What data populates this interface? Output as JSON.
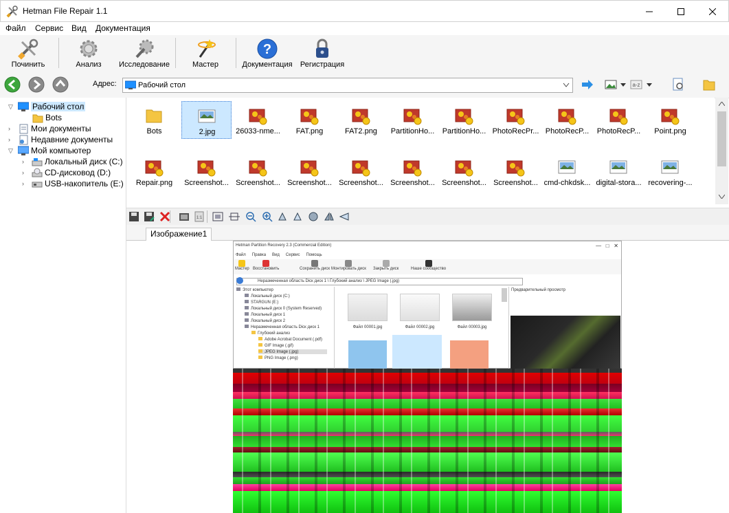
{
  "window": {
    "title": "Hetman File Repair 1.1"
  },
  "menu": [
    "Файл",
    "Сервис",
    "Вид",
    "Документация"
  ],
  "toolbar": {
    "repair": "Починить",
    "analyze": "Анализ",
    "research": "Исследование",
    "wizard": "Мастер",
    "docs": "Документация",
    "register": "Регистрация"
  },
  "address": {
    "label": "Адрес:",
    "value": "Рабочий стол"
  },
  "tree": {
    "desktop": "Рабочий стол",
    "bots": "Bots",
    "my_docs": "Мои документы",
    "recent": "Недавние документы",
    "computer": "Мой компьютер",
    "disk_c": "Локальный диск (C:)",
    "cd_d": "CD-дисковод (D:)",
    "usb_e": "USB-накопитель (E:)"
  },
  "files": [
    "Bots",
    "2.jpg",
    "26033-nme...",
    "FAT.png",
    "FAT2.png",
    "PartitionHo...",
    "PartitionHo...",
    "PhotoRecPr...",
    "PhotoRecP...",
    "PhotoRecP...",
    "Point.png",
    "Repair.png",
    "Screenshot...",
    "Screenshot...",
    "Screenshot...",
    "Screenshot...",
    "Screenshot...",
    "Screenshot...",
    "Screenshot...",
    "cmd-chkdsk...",
    "digital-stora...",
    "recovering-..."
  ],
  "preview_tab": "Изображение1",
  "inner_screenshot": {
    "title": "Hetman Partition Recovery 2.3 (Commercial Edition)",
    "menu": [
      "Файл",
      "Правка",
      "Вид",
      "Сервис",
      "Помощь"
    ],
    "tools": [
      "Мастер",
      "Восстановить",
      "Сохранить диск",
      "Монтировать диск",
      "Закрыть диск",
      "Наше сообщество"
    ],
    "address": "Неразмеченная область Diск диск 1 \\ Глубокий анализ \\ JPEG Image (.jpg)",
    "tree": [
      "Этот компьютер",
      "Локальный диск (C:)",
      "STARGUN (E:)",
      "Локальный диск 0 (System Reserved)",
      "Локальный диск 1",
      "Локальный диск 2",
      "Неразмеченная область Diск диск 1",
      "Глубокий анализ",
      "Adobe Acrobat Document (.pdf)",
      "GIF Image (.gif)",
      "JPEG Image (.jpg)",
      "PNG Image (.png)"
    ],
    "thumbs": [
      "Файл 00001.jpg",
      "Файл 00002.jpg",
      "Файл 00003.jpg"
    ],
    "preview_label": "Предварительный просмотр"
  }
}
